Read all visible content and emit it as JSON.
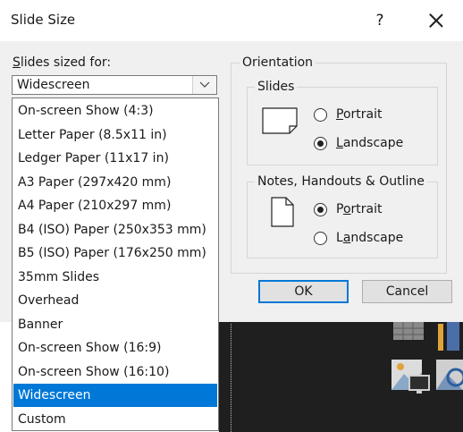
{
  "dialog": {
    "title": "Slide Size",
    "help": "?",
    "sized_for_label_prefix": "S",
    "sized_for_label_rest": "lides sized for:",
    "selected_value": "Widescreen"
  },
  "dropdown_items": [
    "On-screen Show (4:3)",
    "Letter Paper (8.5x11 in)",
    "Ledger Paper (11x17 in)",
    "A3 Paper (297x420 mm)",
    "A4 Paper (210x297 mm)",
    "B4 (ISO) Paper (250x353 mm)",
    "B5 (ISO) Paper (176x250 mm)",
    "35mm Slides",
    "Overhead",
    "Banner",
    "On-screen Show (16:9)",
    "On-screen Show (16:10)",
    "Widescreen",
    "Custom"
  ],
  "selected_index": 12,
  "orientation": {
    "group_label": "Orientation",
    "slides_label": "Slides",
    "slides_portrait_key": "P",
    "slides_portrait_rest": "ortrait",
    "slides_landscape_key": "L",
    "slides_landscape_rest": "andscape",
    "slides_selected": "landscape",
    "notes_label": "Notes, Handouts & Outline",
    "notes_portrait_key": "o",
    "notes_portrait_pre": "P",
    "notes_portrait_rest": "rtrait",
    "notes_landscape_key": "a",
    "notes_landscape_pre": "L",
    "notes_landscape_rest": "ndscape",
    "notes_selected": "portrait"
  },
  "buttons": {
    "ok": "OK",
    "cancel": "Cancel"
  },
  "colors": {
    "dialog_bg": "#f0f0f0",
    "selection": "#0078d7",
    "default_button_border": "#0078d7",
    "background_slide_area": "#1f1f1f"
  }
}
